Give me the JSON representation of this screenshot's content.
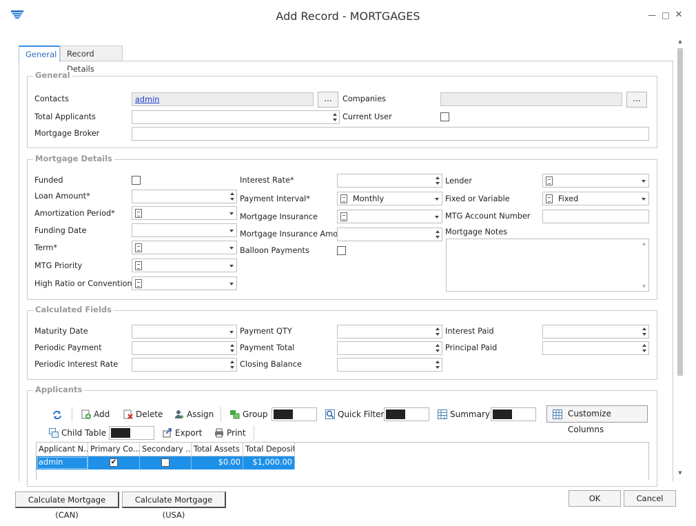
{
  "window": {
    "title": "Add Record - MORTGAGES"
  },
  "tabs": [
    {
      "label": "General"
    },
    {
      "label": "Record Details"
    }
  ],
  "general": {
    "legend": "General",
    "contacts_label": "Contacts",
    "contacts_value": "admin",
    "companies_label": "Companies",
    "total_applicants_label": "Total Applicants",
    "current_user_label": "Current User",
    "mortgage_broker_label": "Mortgage Broker",
    "ellipsis": "..."
  },
  "mortgage_details": {
    "legend": "Mortgage Details",
    "funded": "Funded",
    "loan_amount": "Loan Amount*",
    "amortization_period": "Amortization Period*",
    "funding_date": "Funding Date",
    "term": "Term*",
    "mtg_priority": "MTG Priority",
    "high_ratio": "High Ratio or Conventional",
    "interest_rate": "Interest Rate*",
    "payment_interval": "Payment Interval*",
    "payment_interval_value": "Monthly",
    "mortgage_insurance": "Mortgage Insurance",
    "mortgage_insurance_amount": "Mortgage Insurance Amount",
    "balloon_payments": "Balloon Payments",
    "lender": "Lender",
    "fixed_or_variable": "Fixed or Variable",
    "fixed_or_variable_value": "Fixed",
    "mtg_account_number": "MTG Account Number",
    "mortgage_notes": "Mortgage Notes"
  },
  "calculated": {
    "legend": "Calculated Fields",
    "maturity_date": "Maturity Date",
    "periodic_payment": "Periodic Payment",
    "periodic_interest_rate": "Periodic Interest Rate",
    "payment_qty": "Payment QTY",
    "payment_total": "Payment Total",
    "closing_balance": "Closing Balance",
    "interest_paid": "Interest Paid",
    "principal_paid": "Principal Paid"
  },
  "applicants": {
    "legend": "Applicants",
    "toolbar": {
      "add": "Add",
      "delete": "Delete",
      "assign": "Assign",
      "group": "Group",
      "quick_filter": "Quick Filter",
      "summary": "Summary",
      "customize_columns": "Customize Columns",
      "child_table": "Child Table",
      "export": "Export",
      "print": "Print"
    },
    "columns": [
      "Applicant N...",
      "Primary Co...",
      "Secondary ...",
      "Total Assets",
      "Total Deposit"
    ],
    "rows": [
      {
        "applicant": "admin",
        "primary": true,
        "secondary": false,
        "total_assets": "$0.00",
        "total_deposit": "$1,000.00"
      }
    ]
  },
  "footer": {
    "calc_can": "Calculate Mortgage (CAN)",
    "calc_usa": "Calculate Mortgage (USA)",
    "ok": "OK",
    "cancel": "Cancel"
  }
}
